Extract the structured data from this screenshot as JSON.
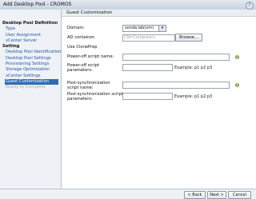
{
  "window": {
    "title": "Add Desktop Pool - CROMOS",
    "help": "?"
  },
  "nav": {
    "pool_definition": "Desktop Pool Definition",
    "type": "Type",
    "user_assignment": "User Assignment",
    "vcenter_server": "vCenter Server",
    "setting": "Setting",
    "pool_identification": "Desktop Pool Identification",
    "pool_settings": "Desktop Pool Settings",
    "provisioning_settings": "Provisioning Settings",
    "storage_optimization": "Storage Optimization",
    "vcenter_settings": "vCenter Settings",
    "guest_customization": "Guest Customization",
    "ready_to_complete": "Ready to Complete"
  },
  "content": {
    "title": "Guest Customization",
    "domain_label": "Domain:",
    "domain_value": "sonda.lab(vm)",
    "ad_container_label": "AD container:",
    "ad_container_value": "CN=Computers",
    "browse": "Browse...",
    "clone_prep": "Use ClonePrep",
    "power_off_script_name_label": "Power-off script name:",
    "power_off_script_params_label": "Power-off script parameters:",
    "post_sync_script_name_label": "Post-synchronization script name:",
    "post_sync_script_params_label": "Post-synchronization script parameters:",
    "example_text": "Example: p1 p2 p3"
  },
  "footer": {
    "back": "< Back",
    "next": "Next >",
    "cancel": "Cancel"
  }
}
